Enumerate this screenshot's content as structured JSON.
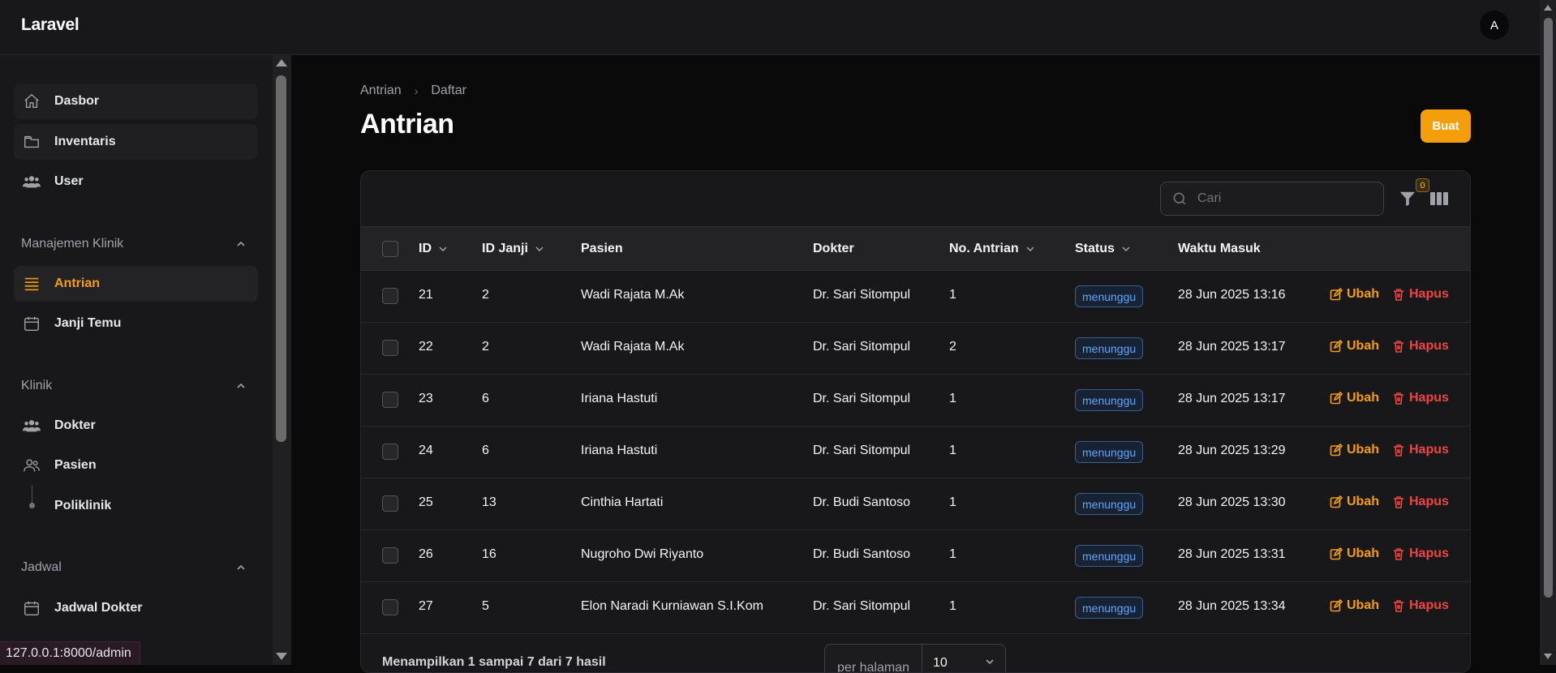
{
  "app": {
    "brand": "Laravel",
    "avatar_initial": "A",
    "accent": "#f59e0b"
  },
  "sidebar": {
    "top_items": [
      {
        "label": "Dasbor",
        "icon": "home-icon"
      },
      {
        "label": "Inventaris",
        "icon": "folder-icon"
      },
      {
        "label": "User",
        "icon": "users-icon"
      }
    ],
    "groups": [
      {
        "label": "Manajemen Klinik",
        "items": [
          {
            "label": "Antrian",
            "icon": "queue-list-icon",
            "active": true
          },
          {
            "label": "Janji Temu",
            "icon": "calendar-icon"
          }
        ]
      },
      {
        "label": "Klinik",
        "items": [
          {
            "label": "Dokter",
            "icon": "users-icon"
          },
          {
            "label": "Pasien",
            "icon": "user-group-icon"
          },
          {
            "label": "Poliklinik",
            "icon": "tree-dot-icon"
          }
        ]
      },
      {
        "label": "Jadwal",
        "items": [
          {
            "label": "Jadwal Dokter",
            "icon": "calendar-icon"
          }
        ]
      }
    ]
  },
  "breadcrumb": {
    "parent": "Antrian",
    "current": "Daftar"
  },
  "page": {
    "title": "Antrian",
    "create_label": "Buat"
  },
  "toolbar": {
    "search_placeholder": "Cari",
    "filter_count": "0"
  },
  "table": {
    "headers": {
      "id": "ID",
      "appointment": "ID Janji",
      "patient": "Pasien",
      "doctor": "Dokter",
      "queue_no": "No. Antrian",
      "status": "Status",
      "entry_time": "Waktu Masuk"
    },
    "edit_label": "Ubah",
    "delete_label": "Hapus",
    "rows": [
      {
        "id": "21",
        "appointment": "2",
        "patient": "Wadi Rajata M.Ak",
        "doctor": "Dr. Sari Sitompul",
        "queue_no": "1",
        "status": "menunggu",
        "entry_time": "28 Jun 2025 13:16"
      },
      {
        "id": "22",
        "appointment": "2",
        "patient": "Wadi Rajata M.Ak",
        "doctor": "Dr. Sari Sitompul",
        "queue_no": "2",
        "status": "menunggu",
        "entry_time": "28 Jun 2025 13:17"
      },
      {
        "id": "23",
        "appointment": "6",
        "patient": "Iriana Hastuti",
        "doctor": "Dr. Sari Sitompul",
        "queue_no": "1",
        "status": "menunggu",
        "entry_time": "28 Jun 2025 13:17"
      },
      {
        "id": "24",
        "appointment": "6",
        "patient": "Iriana Hastuti",
        "doctor": "Dr. Sari Sitompul",
        "queue_no": "1",
        "status": "menunggu",
        "entry_time": "28 Jun 2025 13:29"
      },
      {
        "id": "25",
        "appointment": "13",
        "patient": "Cinthia Hartati",
        "doctor": "Dr. Budi Santoso",
        "queue_no": "1",
        "status": "menunggu",
        "entry_time": "28 Jun 2025 13:30"
      },
      {
        "id": "26",
        "appointment": "16",
        "patient": "Nugroho Dwi Riyanto",
        "doctor": "Dr. Budi Santoso",
        "queue_no": "1",
        "status": "menunggu",
        "entry_time": "28 Jun 2025 13:31"
      },
      {
        "id": "27",
        "appointment": "5",
        "patient": "Elon Naradi Kurniawan S.I.Kom",
        "doctor": "Dr. Sari Sitompul",
        "queue_no": "1",
        "status": "menunggu",
        "entry_time": "28 Jun 2025 13:34"
      }
    ]
  },
  "footer": {
    "summary": "Menampilkan 1 sampai 7 dari 7 hasil",
    "per_page_label": "per halaman",
    "per_page_value": "10"
  },
  "status_bar": {
    "url": "127.0.0.1:8000/admin"
  }
}
